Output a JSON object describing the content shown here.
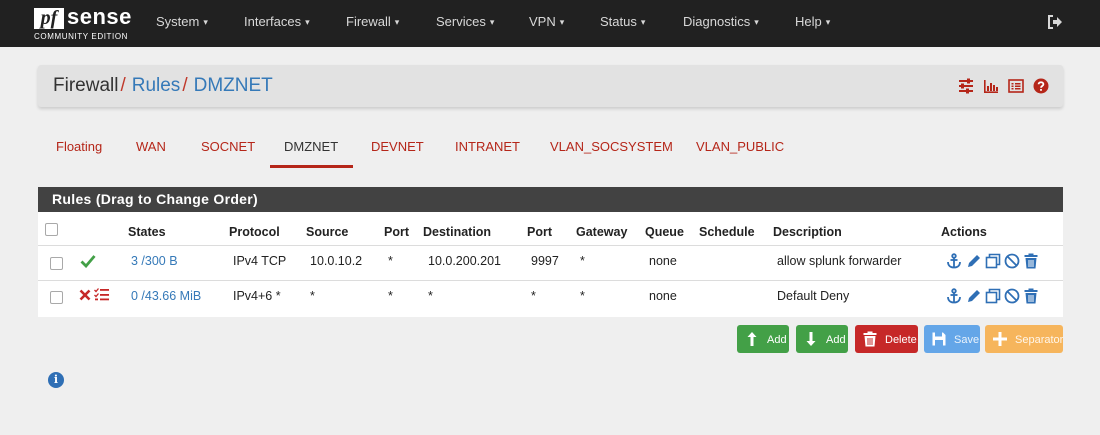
{
  "logo": {
    "pf": "pf",
    "sense": "sense",
    "edition": "COMMUNITY EDITION"
  },
  "nav": {
    "items": [
      {
        "label": "System"
      },
      {
        "label": "Interfaces"
      },
      {
        "label": "Firewall"
      },
      {
        "label": "Services"
      },
      {
        "label": "VPN"
      },
      {
        "label": "Status"
      },
      {
        "label": "Diagnostics"
      },
      {
        "label": "Help"
      }
    ],
    "caret": "▾",
    "logout_icon": "sign-out-icon"
  },
  "breadcrumb": {
    "part1": "Firewall",
    "part2": "Rules",
    "part3": "DMZNET",
    "separator": "/",
    "icons": [
      "sliders-icon",
      "bar-chart-icon",
      "list-icon",
      "help-icon"
    ]
  },
  "tabs": [
    {
      "label": "Floating"
    },
    {
      "label": "WAN"
    },
    {
      "label": "SOCNET"
    },
    {
      "label": "DMZNET",
      "active": true
    },
    {
      "label": "DEVNET"
    },
    {
      "label": "INTRANET"
    },
    {
      "label": "VLAN_SOCSYSTEM"
    },
    {
      "label": "VLAN_PUBLIC"
    }
  ],
  "rules": {
    "title": "Rules (Drag to Change Order)",
    "columns": [
      "States",
      "Protocol",
      "Source",
      "Port",
      "Destination",
      "Port",
      "Gateway",
      "Queue",
      "Schedule",
      "Description",
      "Actions"
    ],
    "rows": [
      {
        "status": "pass",
        "states": "3 /300 B",
        "protocol": "IPv4 TCP",
        "source": "10.0.10.2",
        "sport": "*",
        "destination": "10.0.200.201",
        "dport": "9997",
        "gateway": "*",
        "queue": "none",
        "schedule": "",
        "description": "allow splunk forwarder"
      },
      {
        "status": "block",
        "states": "0 /43.66 MiB",
        "protocol": "IPv4+6 *",
        "source": "*",
        "sport": "*",
        "destination": "*",
        "dport": "*",
        "gateway": "*",
        "queue": "none",
        "schedule": "",
        "description": "Default Deny"
      }
    ]
  },
  "buttons": {
    "add_top": "Add",
    "add_bottom": "Add",
    "delete": "Delete",
    "save": "Save",
    "separator": "Separator"
  },
  "colors": {
    "navbar": "#212121",
    "accent_red": "#b52619",
    "link_blue": "#3579b8",
    "green": "#43a047"
  }
}
